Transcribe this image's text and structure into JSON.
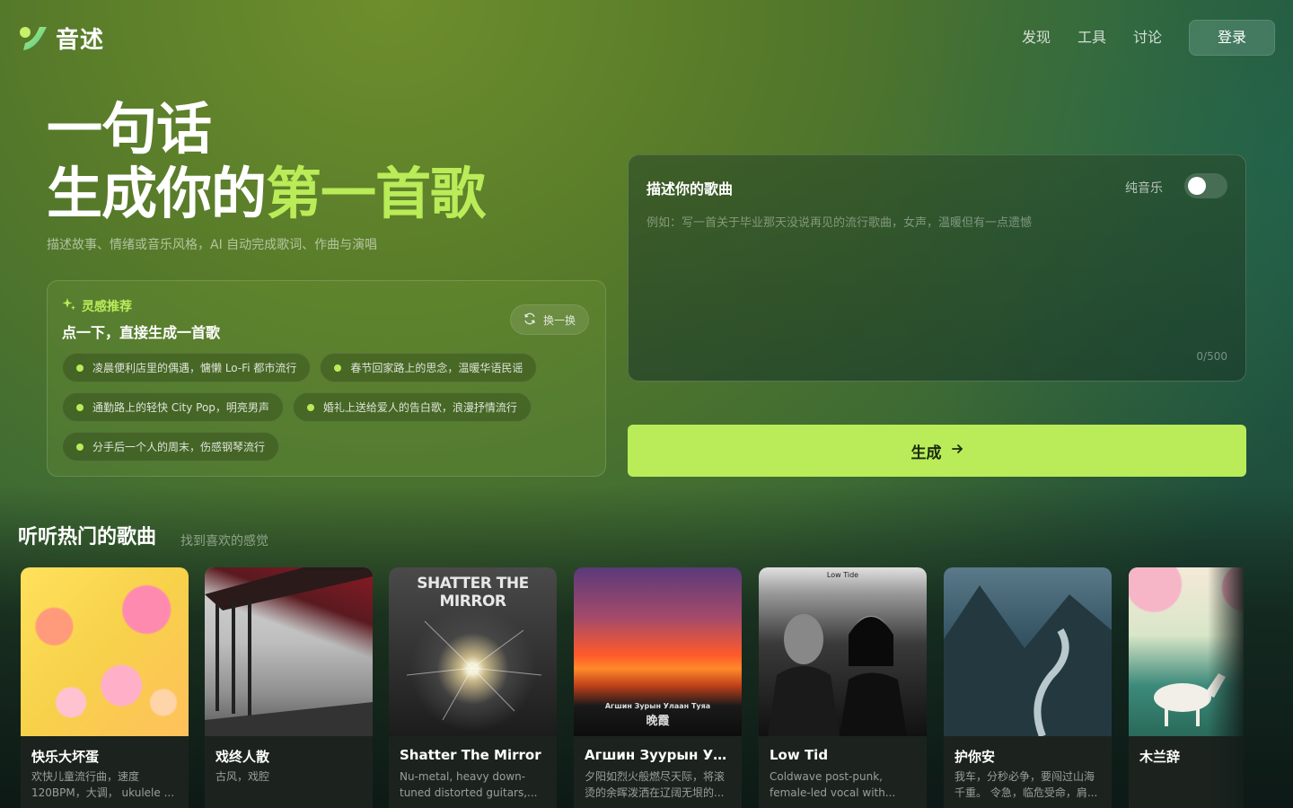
{
  "app": {
    "name": "音述"
  },
  "nav": {
    "items": [
      "发现",
      "工具",
      "讨论"
    ],
    "login": "登录"
  },
  "hero": {
    "line1": "一句话",
    "line2_plain": "生成你的",
    "line2_accent": "第一首歌",
    "subtitle": "描述故事、情绪或音乐风格，AI 自动完成歌词、作曲与演唱"
  },
  "inspiration": {
    "label": "灵感推荐",
    "title": "点一下，直接生成一首歌",
    "refresh": "换一换",
    "chips": [
      "凌晨便利店里的偶遇，慵懒 Lo-Fi 都市流行",
      "春节回家路上的思念，温暖华语民谣",
      "通勤路上的轻快 City Pop，明亮男声",
      "婚礼上送给爱人的告白歌，浪漫抒情流行",
      "分手后一个人的周末，伤感钢琴流行"
    ]
  },
  "describe": {
    "title": "描述你的歌曲",
    "pure_music_label": "纯音乐",
    "pure_music_on": false,
    "placeholder": "例如：写一首关于毕业那天没说再见的流行歌曲，女声，温暖但有一点遗憾",
    "counter": "0/500"
  },
  "generate": {
    "label": "生成"
  },
  "hot": {
    "title": "听听热门的歌曲",
    "subtitle": "找到喜欢的感觉",
    "songs": [
      {
        "name": "快乐大坏蛋",
        "desc": "欢快儿童流行曲，速度120BPM，大调， ukulele ..."
      },
      {
        "name": "戏终人散",
        "desc": "古风，戏腔"
      },
      {
        "name": "Shatter The Mirror",
        "desc": "Nu-metal, heavy down-tuned distorted guitars,...",
        "cover_text": "SHATTER THE MIRROR"
      },
      {
        "name": "Агшин Зуурын Ул...",
        "desc": "夕阳如烈火般燃尽天际，将滚烫的余晖泼洒在辽阔无垠的...",
        "cover_text": "Агшин Зурын Улаан Туяа",
        "cover_text2": "晚霞"
      },
      {
        "name": "Low Tid",
        "desc": "Coldwave post-punk, female-led vocal with...",
        "cover_text": "Low Tide"
      },
      {
        "name": "护你安",
        "desc": "我车，分秒必争，要闯过山海千重。 令急，临危受命，肩..."
      },
      {
        "name": "木兰辞",
        "desc": ""
      }
    ]
  },
  "colors": {
    "accent": "#b9ec58",
    "button_text": "#1a2a0e"
  }
}
